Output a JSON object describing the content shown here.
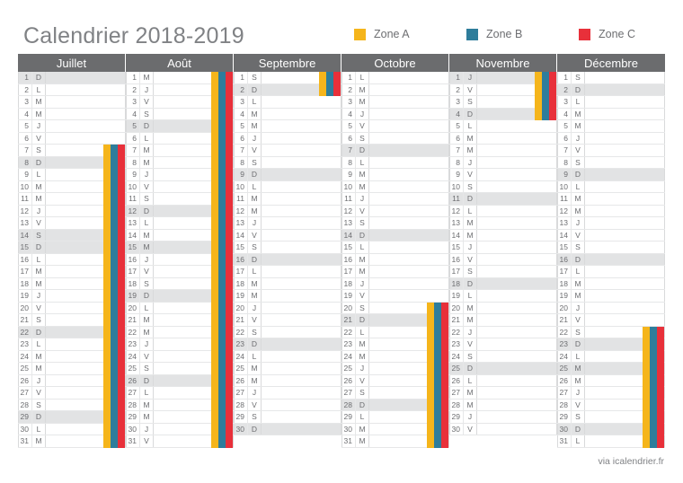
{
  "header": {
    "title": "Calendrier 2018-2019"
  },
  "legend": {
    "items": [
      {
        "label": "Zone A",
        "color": "#f5b51b"
      },
      {
        "label": "Zone B",
        "color": "#2e7d9b"
      },
      {
        "label": "Zone C",
        "color": "#e8303a"
      }
    ]
  },
  "footer": {
    "credit": "via icalendrier.fr"
  },
  "colors": {
    "header_bg": "#6b6c6e",
    "title": "#808285",
    "text": "#6d6e71",
    "grid": "#e6e7e8",
    "sunday_bg": "#e2e3e4",
    "holiday_bg": "#d6d7d8",
    "zone_a": "#f5b51b",
    "zone_b": "#2e7d9b",
    "zone_c": "#e8303a"
  },
  "months": [
    {
      "name": "Juillet",
      "days": [
        {
          "n": "1",
          "l": "D",
          "sun": true
        },
        {
          "n": "2",
          "l": "L"
        },
        {
          "n": "3",
          "l": "M"
        },
        {
          "n": "4",
          "l": "M"
        },
        {
          "n": "5",
          "l": "J"
        },
        {
          "n": "6",
          "l": "V"
        },
        {
          "n": "7",
          "l": "S"
        },
        {
          "n": "8",
          "l": "D",
          "sun": true
        },
        {
          "n": "9",
          "l": "L"
        },
        {
          "n": "10",
          "l": "M"
        },
        {
          "n": "11",
          "l": "M"
        },
        {
          "n": "12",
          "l": "J"
        },
        {
          "n": "13",
          "l": "V"
        },
        {
          "n": "14",
          "l": "S",
          "sun": true
        },
        {
          "n": "15",
          "l": "D",
          "sun": true
        },
        {
          "n": "16",
          "l": "L"
        },
        {
          "n": "17",
          "l": "M"
        },
        {
          "n": "18",
          "l": "M"
        },
        {
          "n": "19",
          "l": "J"
        },
        {
          "n": "20",
          "l": "V"
        },
        {
          "n": "21",
          "l": "S"
        },
        {
          "n": "22",
          "l": "D",
          "sun": true
        },
        {
          "n": "23",
          "l": "L"
        },
        {
          "n": "24",
          "l": "M"
        },
        {
          "n": "25",
          "l": "M"
        },
        {
          "n": "26",
          "l": "J"
        },
        {
          "n": "27",
          "l": "V"
        },
        {
          "n": "28",
          "l": "S"
        },
        {
          "n": "29",
          "l": "D",
          "sun": true
        },
        {
          "n": "30",
          "l": "L"
        },
        {
          "n": "31",
          "l": "M"
        }
      ],
      "vacation": {
        "from": 7,
        "to": 31,
        "zones": [
          "A",
          "B",
          "C"
        ]
      }
    },
    {
      "name": "Août",
      "days": [
        {
          "n": "1",
          "l": "M"
        },
        {
          "n": "2",
          "l": "J"
        },
        {
          "n": "3",
          "l": "V"
        },
        {
          "n": "4",
          "l": "S"
        },
        {
          "n": "5",
          "l": "D",
          "sun": true
        },
        {
          "n": "6",
          "l": "L"
        },
        {
          "n": "7",
          "l": "M"
        },
        {
          "n": "8",
          "l": "M"
        },
        {
          "n": "9",
          "l": "J"
        },
        {
          "n": "10",
          "l": "V"
        },
        {
          "n": "11",
          "l": "S"
        },
        {
          "n": "12",
          "l": "D",
          "sun": true
        },
        {
          "n": "13",
          "l": "L"
        },
        {
          "n": "14",
          "l": "M"
        },
        {
          "n": "15",
          "l": "M",
          "sun": true
        },
        {
          "n": "16",
          "l": "J"
        },
        {
          "n": "17",
          "l": "V"
        },
        {
          "n": "18",
          "l": "S"
        },
        {
          "n": "19",
          "l": "D",
          "sun": true
        },
        {
          "n": "20",
          "l": "L"
        },
        {
          "n": "21",
          "l": "M"
        },
        {
          "n": "22",
          "l": "M"
        },
        {
          "n": "23",
          "l": "J"
        },
        {
          "n": "24",
          "l": "V"
        },
        {
          "n": "25",
          "l": "S"
        },
        {
          "n": "26",
          "l": "D",
          "sun": true
        },
        {
          "n": "27",
          "l": "L"
        },
        {
          "n": "28",
          "l": "M"
        },
        {
          "n": "29",
          "l": "M"
        },
        {
          "n": "30",
          "l": "J"
        },
        {
          "n": "31",
          "l": "V"
        }
      ],
      "vacation": {
        "from": 1,
        "to": 31,
        "zones": [
          "A",
          "B",
          "C"
        ]
      }
    },
    {
      "name": "Septembre",
      "days": [
        {
          "n": "1",
          "l": "S"
        },
        {
          "n": "2",
          "l": "D",
          "sun": true
        },
        {
          "n": "3",
          "l": "L"
        },
        {
          "n": "4",
          "l": "M"
        },
        {
          "n": "5",
          "l": "M"
        },
        {
          "n": "6",
          "l": "J"
        },
        {
          "n": "7",
          "l": "V"
        },
        {
          "n": "8",
          "l": "S"
        },
        {
          "n": "9",
          "l": "D",
          "sun": true
        },
        {
          "n": "10",
          "l": "L"
        },
        {
          "n": "11",
          "l": "M"
        },
        {
          "n": "12",
          "l": "M"
        },
        {
          "n": "13",
          "l": "J"
        },
        {
          "n": "14",
          "l": "V"
        },
        {
          "n": "15",
          "l": "S"
        },
        {
          "n": "16",
          "l": "D",
          "sun": true
        },
        {
          "n": "17",
          "l": "L"
        },
        {
          "n": "18",
          "l": "M"
        },
        {
          "n": "19",
          "l": "M"
        },
        {
          "n": "20",
          "l": "J"
        },
        {
          "n": "21",
          "l": "V"
        },
        {
          "n": "22",
          "l": "S"
        },
        {
          "n": "23",
          "l": "D",
          "sun": true
        },
        {
          "n": "24",
          "l": "L"
        },
        {
          "n": "25",
          "l": "M"
        },
        {
          "n": "26",
          "l": "M"
        },
        {
          "n": "27",
          "l": "J"
        },
        {
          "n": "28",
          "l": "V"
        },
        {
          "n": "29",
          "l": "S"
        },
        {
          "n": "30",
          "l": "D",
          "sun": true
        }
      ],
      "vacation": {
        "from": 1,
        "to": 2,
        "zones": [
          "A",
          "B",
          "C"
        ]
      }
    },
    {
      "name": "Octobre",
      "days": [
        {
          "n": "1",
          "l": "L"
        },
        {
          "n": "2",
          "l": "M"
        },
        {
          "n": "3",
          "l": "M"
        },
        {
          "n": "4",
          "l": "J"
        },
        {
          "n": "5",
          "l": "V"
        },
        {
          "n": "6",
          "l": "S"
        },
        {
          "n": "7",
          "l": "D",
          "sun": true
        },
        {
          "n": "8",
          "l": "L"
        },
        {
          "n": "9",
          "l": "M"
        },
        {
          "n": "10",
          "l": "M"
        },
        {
          "n": "11",
          "l": "J"
        },
        {
          "n": "12",
          "l": "V"
        },
        {
          "n": "13",
          "l": "S"
        },
        {
          "n": "14",
          "l": "D",
          "sun": true
        },
        {
          "n": "15",
          "l": "L"
        },
        {
          "n": "16",
          "l": "M"
        },
        {
          "n": "17",
          "l": "M"
        },
        {
          "n": "18",
          "l": "J"
        },
        {
          "n": "19",
          "l": "V"
        },
        {
          "n": "20",
          "l": "S"
        },
        {
          "n": "21",
          "l": "D",
          "sun": true
        },
        {
          "n": "22",
          "l": "L"
        },
        {
          "n": "23",
          "l": "M"
        },
        {
          "n": "24",
          "l": "M"
        },
        {
          "n": "25",
          "l": "J"
        },
        {
          "n": "26",
          "l": "V"
        },
        {
          "n": "27",
          "l": "S"
        },
        {
          "n": "28",
          "l": "D",
          "sun": true
        },
        {
          "n": "29",
          "l": "L"
        },
        {
          "n": "30",
          "l": "M"
        },
        {
          "n": "31",
          "l": "M"
        }
      ],
      "vacation": {
        "from": 20,
        "to": 31,
        "zones": [
          "A",
          "B",
          "C"
        ]
      }
    },
    {
      "name": "Novembre",
      "days": [
        {
          "n": "1",
          "l": "J",
          "sun": true
        },
        {
          "n": "2",
          "l": "V"
        },
        {
          "n": "3",
          "l": "S"
        },
        {
          "n": "4",
          "l": "D",
          "sun": true
        },
        {
          "n": "5",
          "l": "L"
        },
        {
          "n": "6",
          "l": "M"
        },
        {
          "n": "7",
          "l": "M"
        },
        {
          "n": "8",
          "l": "J"
        },
        {
          "n": "9",
          "l": "V"
        },
        {
          "n": "10",
          "l": "S"
        },
        {
          "n": "11",
          "l": "D",
          "sun": true
        },
        {
          "n": "12",
          "l": "L"
        },
        {
          "n": "13",
          "l": "M"
        },
        {
          "n": "14",
          "l": "M"
        },
        {
          "n": "15",
          "l": "J"
        },
        {
          "n": "16",
          "l": "V"
        },
        {
          "n": "17",
          "l": "S"
        },
        {
          "n": "18",
          "l": "D",
          "sun": true
        },
        {
          "n": "19",
          "l": "L"
        },
        {
          "n": "20",
          "l": "M"
        },
        {
          "n": "21",
          "l": "M"
        },
        {
          "n": "22",
          "l": "J"
        },
        {
          "n": "23",
          "l": "V"
        },
        {
          "n": "24",
          "l": "S"
        },
        {
          "n": "25",
          "l": "D",
          "sun": true
        },
        {
          "n": "26",
          "l": "L"
        },
        {
          "n": "27",
          "l": "M"
        },
        {
          "n": "28",
          "l": "M"
        },
        {
          "n": "29",
          "l": "J"
        },
        {
          "n": "30",
          "l": "V"
        }
      ],
      "vacation": {
        "from": 1,
        "to": 4,
        "zones": [
          "A",
          "B",
          "C"
        ]
      }
    },
    {
      "name": "Décembre",
      "days": [
        {
          "n": "1",
          "l": "S"
        },
        {
          "n": "2",
          "l": "D",
          "sun": true
        },
        {
          "n": "3",
          "l": "L"
        },
        {
          "n": "4",
          "l": "M"
        },
        {
          "n": "5",
          "l": "M"
        },
        {
          "n": "6",
          "l": "J"
        },
        {
          "n": "7",
          "l": "V"
        },
        {
          "n": "8",
          "l": "S"
        },
        {
          "n": "9",
          "l": "D",
          "sun": true
        },
        {
          "n": "10",
          "l": "L"
        },
        {
          "n": "11",
          "l": "M"
        },
        {
          "n": "12",
          "l": "M"
        },
        {
          "n": "13",
          "l": "J"
        },
        {
          "n": "14",
          "l": "V"
        },
        {
          "n": "15",
          "l": "S"
        },
        {
          "n": "16",
          "l": "D",
          "sun": true
        },
        {
          "n": "17",
          "l": "L"
        },
        {
          "n": "18",
          "l": "M"
        },
        {
          "n": "19",
          "l": "M"
        },
        {
          "n": "20",
          "l": "J"
        },
        {
          "n": "21",
          "l": "V"
        },
        {
          "n": "22",
          "l": "S"
        },
        {
          "n": "23",
          "l": "D",
          "sun": true
        },
        {
          "n": "24",
          "l": "L"
        },
        {
          "n": "25",
          "l": "M",
          "sun": true
        },
        {
          "n": "26",
          "l": "M"
        },
        {
          "n": "27",
          "l": "J"
        },
        {
          "n": "28",
          "l": "V"
        },
        {
          "n": "29",
          "l": "S"
        },
        {
          "n": "30",
          "l": "D",
          "sun": true
        },
        {
          "n": "31",
          "l": "L"
        }
      ],
      "vacation": {
        "from": 22,
        "to": 31,
        "zones": [
          "A",
          "B",
          "C"
        ]
      }
    }
  ]
}
